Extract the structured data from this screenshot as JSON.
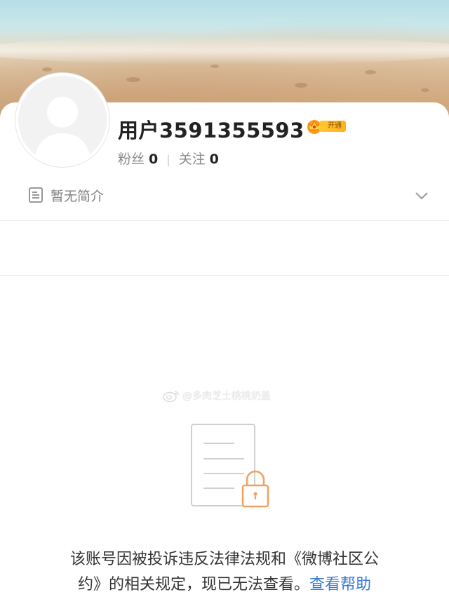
{
  "profile": {
    "username": "用户3591355593",
    "vip_badge_label": "开通",
    "followers_label": "粉丝",
    "followers_count": "0",
    "stats_separator": "|",
    "following_label": "关注",
    "following_count": "0",
    "intro_text": "暂无简介"
  },
  "watermark": {
    "text": "@多肉芝士桃桃奶盖"
  },
  "notice": {
    "line1": "该账号因被投诉违反法律法规和《微博社区公",
    "line2_prefix": "约》的相关规定，现已无法查看。",
    "help_link": "查看帮助"
  },
  "colors": {
    "link": "#3a7bd5",
    "lock_icon": "#f0a060",
    "vip_badge": "#ffc934"
  },
  "icons": {
    "avatar": "default-avatar-silhouette",
    "vip": "crown-icon",
    "intro": "document-icon",
    "expand": "chevron-down-icon",
    "watermark": "weibo-logo-icon",
    "locked": "locked-document-icon"
  }
}
